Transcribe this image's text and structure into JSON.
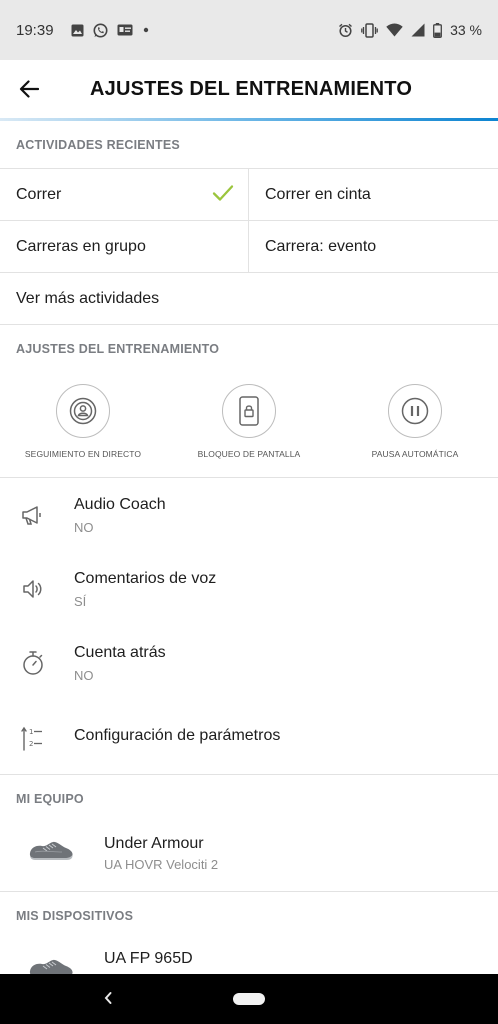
{
  "status": {
    "time": "19:39",
    "battery": "33 %"
  },
  "header": {
    "title": "AJUSTES DEL ENTRENAMIENTO"
  },
  "recent": {
    "header": "ACTIVIDADES RECIENTES",
    "items": [
      "Correr",
      "Correr en cinta",
      "Carreras en grupo",
      "Carrera: evento"
    ],
    "selected": "Correr",
    "more": "Ver más actividades"
  },
  "training": {
    "header": "AJUSTES DEL ENTRENAMIENTO",
    "features": [
      {
        "label": "SEGUIMIENTO EN DIRECTO",
        "icon": "live-tracking-icon"
      },
      {
        "label": "BLOQUEO DE PANTALLA",
        "icon": "screen-lock-icon"
      },
      {
        "label": "PAUSA AUTOMÁTICA",
        "icon": "auto-pause-icon"
      }
    ],
    "settings": [
      {
        "title": "Audio Coach",
        "value": "NO",
        "icon": "megaphone-icon"
      },
      {
        "title": "Comentarios de voz",
        "value": "SÍ",
        "icon": "speaker-icon"
      },
      {
        "title": "Cuenta atrás",
        "value": "NO",
        "icon": "stopwatch-icon"
      },
      {
        "title": "Configuración de parámetros",
        "value": "",
        "icon": "parameters-icon"
      }
    ]
  },
  "gear": {
    "header": "MI EQUIPO",
    "brand": "Under Armour",
    "model": "UA HOVR Velociti 2"
  },
  "devices": {
    "header": "MIS DISPOSITIVOS",
    "name": "UA FP 965D"
  },
  "colors": {
    "accent_check": "#9bc53d",
    "header_gradient_end": "#0d84d1"
  }
}
